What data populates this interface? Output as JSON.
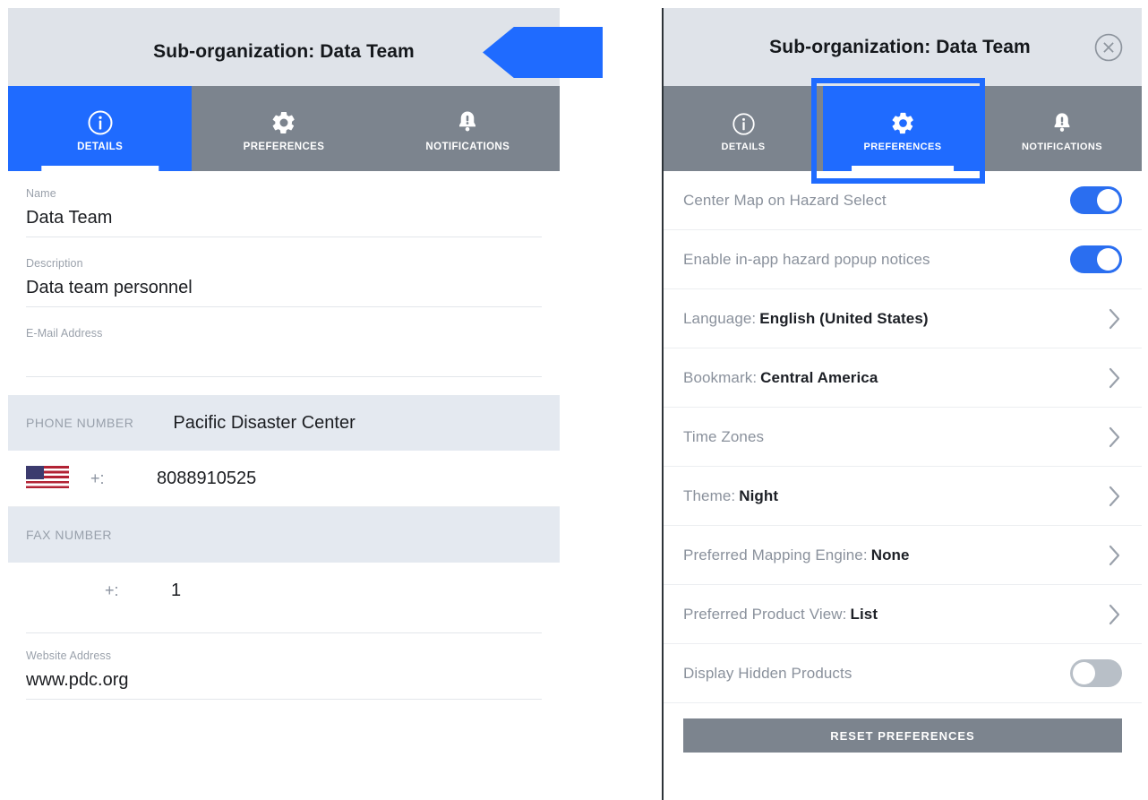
{
  "colors": {
    "accent_blue": "#1f6bff",
    "toggle_on": "#2a6ef0",
    "toggle_off": "#b8bfc7",
    "tab_inactive": "#7c848e",
    "header_band": "#dfe3e9",
    "section_band": "#e4e9f0",
    "label_gray": "#9aa1ab"
  },
  "left_panel": {
    "title": "Sub-organization: Data Team",
    "tabs": [
      {
        "label": "DETAILS",
        "icon": "info-circle-icon",
        "active": true
      },
      {
        "label": "PREFERENCES",
        "icon": "gear-icon",
        "active": false
      },
      {
        "label": "NOTIFICATIONS",
        "icon": "bell-alert-icon",
        "active": false
      }
    ],
    "fields": [
      {
        "label": "Name",
        "value": "Data Team"
      },
      {
        "label": "Description",
        "value": "Data team personnel"
      },
      {
        "label": "E-Mail Address",
        "value": ""
      }
    ],
    "phone_section": {
      "band_label": "PHONE NUMBER",
      "band_value": "Pacific Disaster Center",
      "country_flag": "us-flag-icon",
      "prefix": "+:",
      "number": "8088910525"
    },
    "fax_section": {
      "band_label": "FAX NUMBER",
      "prefix": "+:",
      "number": "1"
    },
    "website": {
      "label": "Website Address",
      "value": "www.pdc.org"
    },
    "callout": {
      "shape": "left-pointing-arrow",
      "color": "#1f6bff"
    }
  },
  "right_panel": {
    "title": "Sub-organization: Data Team",
    "close_icon": "close-circle-icon",
    "tabs": [
      {
        "label": "DETAILS",
        "icon": "info-circle-icon",
        "active": false
      },
      {
        "label": "PREFERENCES",
        "icon": "gear-icon",
        "active": true
      },
      {
        "label": "NOTIFICATIONS",
        "icon": "bell-alert-icon",
        "active": false
      }
    ],
    "highlight": {
      "target": "PREFERENCES",
      "color": "#1f6bff"
    },
    "preferences": [
      {
        "type": "toggle",
        "label": "Center Map on Hazard Select",
        "value": "",
        "state": "on"
      },
      {
        "type": "toggle",
        "label": "Enable in-app hazard popup notices",
        "value": "",
        "state": "on"
      },
      {
        "type": "nav",
        "label": "Language:",
        "value": "English (United States)"
      },
      {
        "type": "nav",
        "label": "Bookmark:",
        "value": "Central America"
      },
      {
        "type": "nav",
        "label": "Time Zones",
        "value": ""
      },
      {
        "type": "nav",
        "label": "Theme:",
        "value": "Night"
      },
      {
        "type": "nav",
        "label": "Preferred Mapping Engine:",
        "value": "None"
      },
      {
        "type": "nav",
        "label": "Preferred Product View:",
        "value": "List"
      },
      {
        "type": "toggle",
        "label": "Display Hidden Products",
        "value": "",
        "state": "off"
      }
    ],
    "reset_label": "RESET PREFERENCES"
  }
}
